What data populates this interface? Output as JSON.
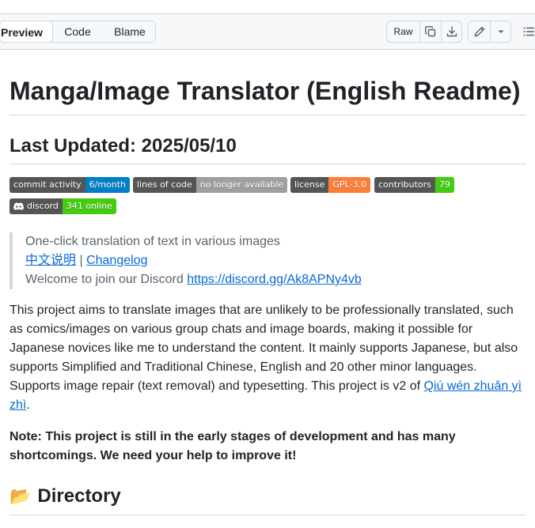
{
  "toolbar": {
    "tabs": [
      "Preview",
      "Code",
      "Blame"
    ],
    "raw_label": "Raw",
    "icons": {
      "copy": "copy-icon",
      "download": "download-icon",
      "edit": "pencil-icon",
      "dropdown": "triangle-down-icon",
      "outline": "list-unordered-icon"
    }
  },
  "readme": {
    "title": "Manga/Image Translator (English Readme)",
    "last_updated": "Last Updated: 2025/05/10",
    "badges": {
      "commit": {
        "label": "commit activity",
        "value": "6/month",
        "color": "#007ec6"
      },
      "loc": {
        "label": "lines of code",
        "value": "no longer available",
        "color": "#9f9f9f"
      },
      "license": {
        "label": "license",
        "value": "GPL-3.0",
        "color": "#fe7d37"
      },
      "contributors": {
        "label": "contributors",
        "value": "79",
        "color": "#4c1"
      },
      "discord": {
        "label": "discord",
        "value": "341 online",
        "color": "#4c1",
        "icon": "discord-icon"
      }
    },
    "quote": {
      "line1": "One-click translation of text in various images",
      "link_cn": "中文说明",
      "sep": " | ",
      "link_changelog": "Changelog",
      "discord_text": "Welcome to join our Discord ",
      "discord_url": "https://discord.gg/Ak8APNy4vb"
    },
    "intro": "This project aims to translate images that are unlikely to be professionally translated, such as comics/images on various group chats and image boards, making it possible for Japanese novices like me to understand the content. It mainly supports Japanese, but also supports Simplified and Traditional Chinese, English and 20 other minor languages. Supports image repair (text removal) and typesetting. This project is v2 of ",
    "intro_link": "Qiú wén zhuǎn yì zhì",
    "intro_end": ".",
    "note": "Note: This project is still in the early stages of development and has many shortcomings. We need your help to improve it!",
    "directory_emoji": "📂",
    "directory": "Directory"
  }
}
